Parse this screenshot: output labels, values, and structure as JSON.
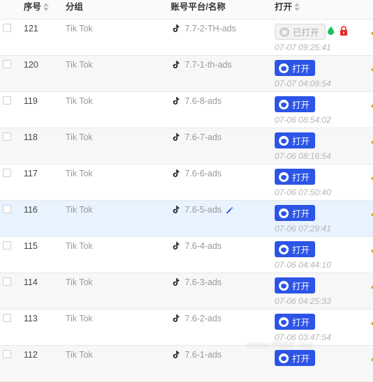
{
  "headers": {
    "num": "序号",
    "group": "分组",
    "account": "账号平台/名称",
    "open": "打开"
  },
  "colors": {
    "accent": "#2c54e7",
    "rowHighlight": "#e8f3ff",
    "dropGreen": "#19c25a",
    "lockRed": "#e02828"
  },
  "rows": [
    {
      "num": "121",
      "group": "Tik Tok",
      "name": "7.7-2-TH-ads",
      "button": "已打开",
      "time": "07-07 09:25:41",
      "state": "opened"
    },
    {
      "num": "120",
      "group": "Tik Tok",
      "name": "7.7-1-th-ads",
      "button": "打开",
      "time": "07-07 04:09:54"
    },
    {
      "num": "119",
      "group": "Tik Tok",
      "name": "7.6-8-ads",
      "button": "打开",
      "time": "07-06 08:54:02"
    },
    {
      "num": "118",
      "group": "Tik Tok",
      "name": "7.6-7-ads",
      "button": "打开",
      "time": "07-06 08:16:54"
    },
    {
      "num": "117",
      "group": "Tik Tok",
      "name": "7.6-6-ads",
      "button": "打开",
      "time": "07-06 07:50:40"
    },
    {
      "num": "116",
      "group": "Tik Tok",
      "name": "7.6-5-ads",
      "button": "打开",
      "time": "07-06 07:29:41",
      "highlight": true
    },
    {
      "num": "115",
      "group": "Tik Tok",
      "name": "7.6-4-ads",
      "button": "打开",
      "time": "07-06 04:44:10"
    },
    {
      "num": "114",
      "group": "Tik Tok",
      "name": "7.6-3-ads",
      "button": "打开",
      "time": "07-06 04:25:33"
    },
    {
      "num": "113",
      "group": "Tik Tok",
      "name": "7.6-2-ads",
      "button": "打开",
      "time": "07-06 03:47:54"
    },
    {
      "num": "112",
      "group": "Tik Tok",
      "name": "7.6-1-ads",
      "button": "打开",
      "time": ""
    }
  ],
  "watermark": "www.9969.net"
}
